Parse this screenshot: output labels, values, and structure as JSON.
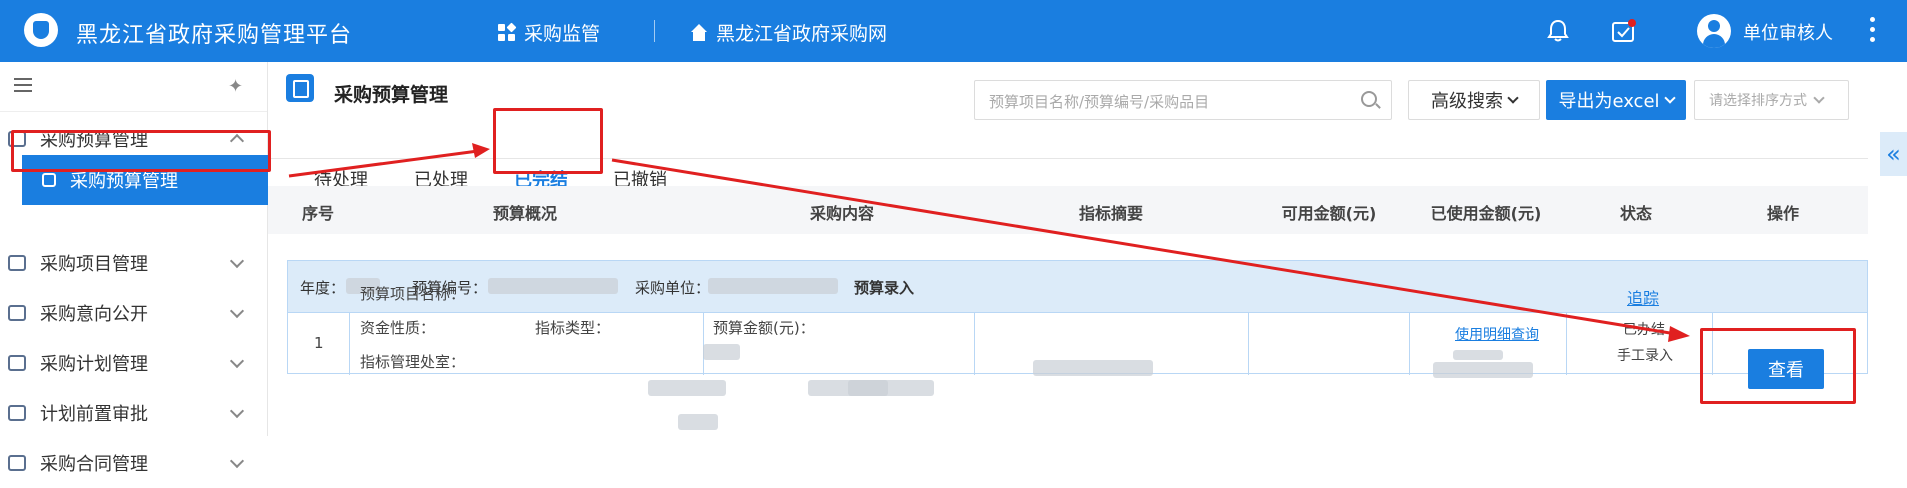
{
  "header": {
    "app_title": "黑龙江省政府采购管理平台",
    "nav": [
      {
        "label": "采购监管",
        "icon": "grid-icon"
      },
      {
        "label": "黑龙江省政府采购网",
        "icon": "home-icon"
      }
    ],
    "username": "单位审核人",
    "colors": {
      "bar": "#1a7ee0",
      "accent": "#1a7ee0",
      "annotation": "#e02020"
    }
  },
  "sidebar": {
    "items": [
      {
        "label": "采购预算管理",
        "expanded": true
      },
      {
        "label": "采购预算管理",
        "sub": true,
        "active": true
      },
      {
        "label": "采购项目管理"
      },
      {
        "label": "采购意向公开"
      },
      {
        "label": "采购计划管理"
      },
      {
        "label": "计划前置审批"
      },
      {
        "label": "采购合同管理"
      }
    ]
  },
  "page": {
    "title": "采购预算管理",
    "search_placeholder": "预算项目名称/预算编号/采购品目",
    "advanced_search": "高级搜索",
    "export_label": "导出为excel",
    "sort_placeholder": "请选择排序方式"
  },
  "tabs": [
    "待处理",
    "已处理",
    "已完结",
    "已撤销"
  ],
  "active_tab": "已完结",
  "table": {
    "headers": [
      "序号",
      "预算概况",
      "采购内容",
      "指标摘要",
      "可用金额(元)",
      "已使用金额(元)",
      "状态",
      "操作"
    ],
    "group": {
      "year_label": "年度：",
      "budget_no_label": "预算编号：",
      "unit_label": "采购单位：",
      "tag": "预算录入"
    },
    "row": {
      "index": "1",
      "overview": [
        "预算项目名称：",
        "资金性质：",
        "指标类型：",
        "指标管理处室："
      ],
      "content": "预算金额(元)：",
      "usage_link": "使用明细查询",
      "track_link": "追踪",
      "status": "已办结",
      "entry_type": "手工录入",
      "action": "查看"
    }
  }
}
